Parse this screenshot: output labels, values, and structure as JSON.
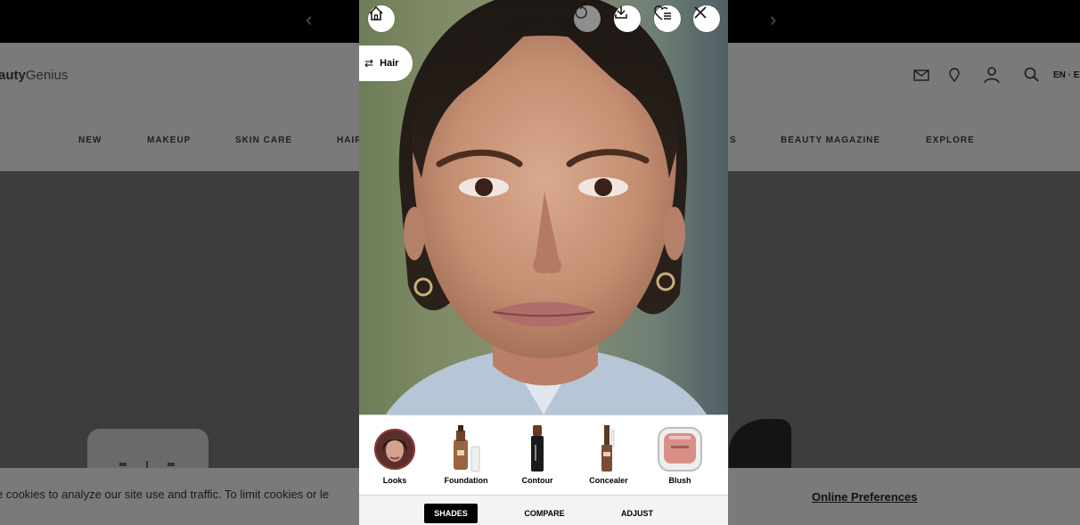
{
  "topbar": {
    "prev_arrow": "‹",
    "next_arrow": "›"
  },
  "header": {
    "brand_bold": "auty",
    "brand_light": "Genius",
    "icons": [
      "mail-icon",
      "location-pin-icon",
      "account-icon",
      "search-icon"
    ],
    "language": "EN · E"
  },
  "nav": {
    "items": [
      {
        "label": "NEW"
      },
      {
        "label": "MAKEUP"
      },
      {
        "label": "SKIN CARE"
      },
      {
        "label": "HAIR"
      },
      {
        "label": "S"
      },
      {
        "label": "BEAUTY MAGAZINE"
      },
      {
        "label": "EXPLORE"
      }
    ]
  },
  "cookie": {
    "text": "e cookies to analyze our site use and traffic. To limit cookies or le",
    "link": "Online Preferences"
  },
  "modal": {
    "toolbar_icons": [
      "home-icon",
      "reset-icon",
      "download-icon",
      "favorites-list-icon",
      "close-icon"
    ],
    "hair_toggle": {
      "icon": "⇄",
      "label": "Hair"
    },
    "products": [
      {
        "label": "Looks",
        "icon": "looks-avatar-icon"
      },
      {
        "label": "Foundation",
        "icon": "foundation-bottle-icon"
      },
      {
        "label": "Contour",
        "icon": "contour-stick-icon"
      },
      {
        "label": "Concealer",
        "icon": "concealer-tube-icon"
      },
      {
        "label": "Blush",
        "icon": "blush-compact-icon"
      }
    ],
    "tabs": [
      {
        "label": "SHADES",
        "active": true
      },
      {
        "label": "COMPARE",
        "active": false
      },
      {
        "label": "ADJUST",
        "active": false
      }
    ]
  },
  "colors": {
    "overlay_dark": "#3d3d3d",
    "overlay_header": "#7a7a7a",
    "active_tab": "#000000",
    "blush_pink": "#d98f86"
  }
}
